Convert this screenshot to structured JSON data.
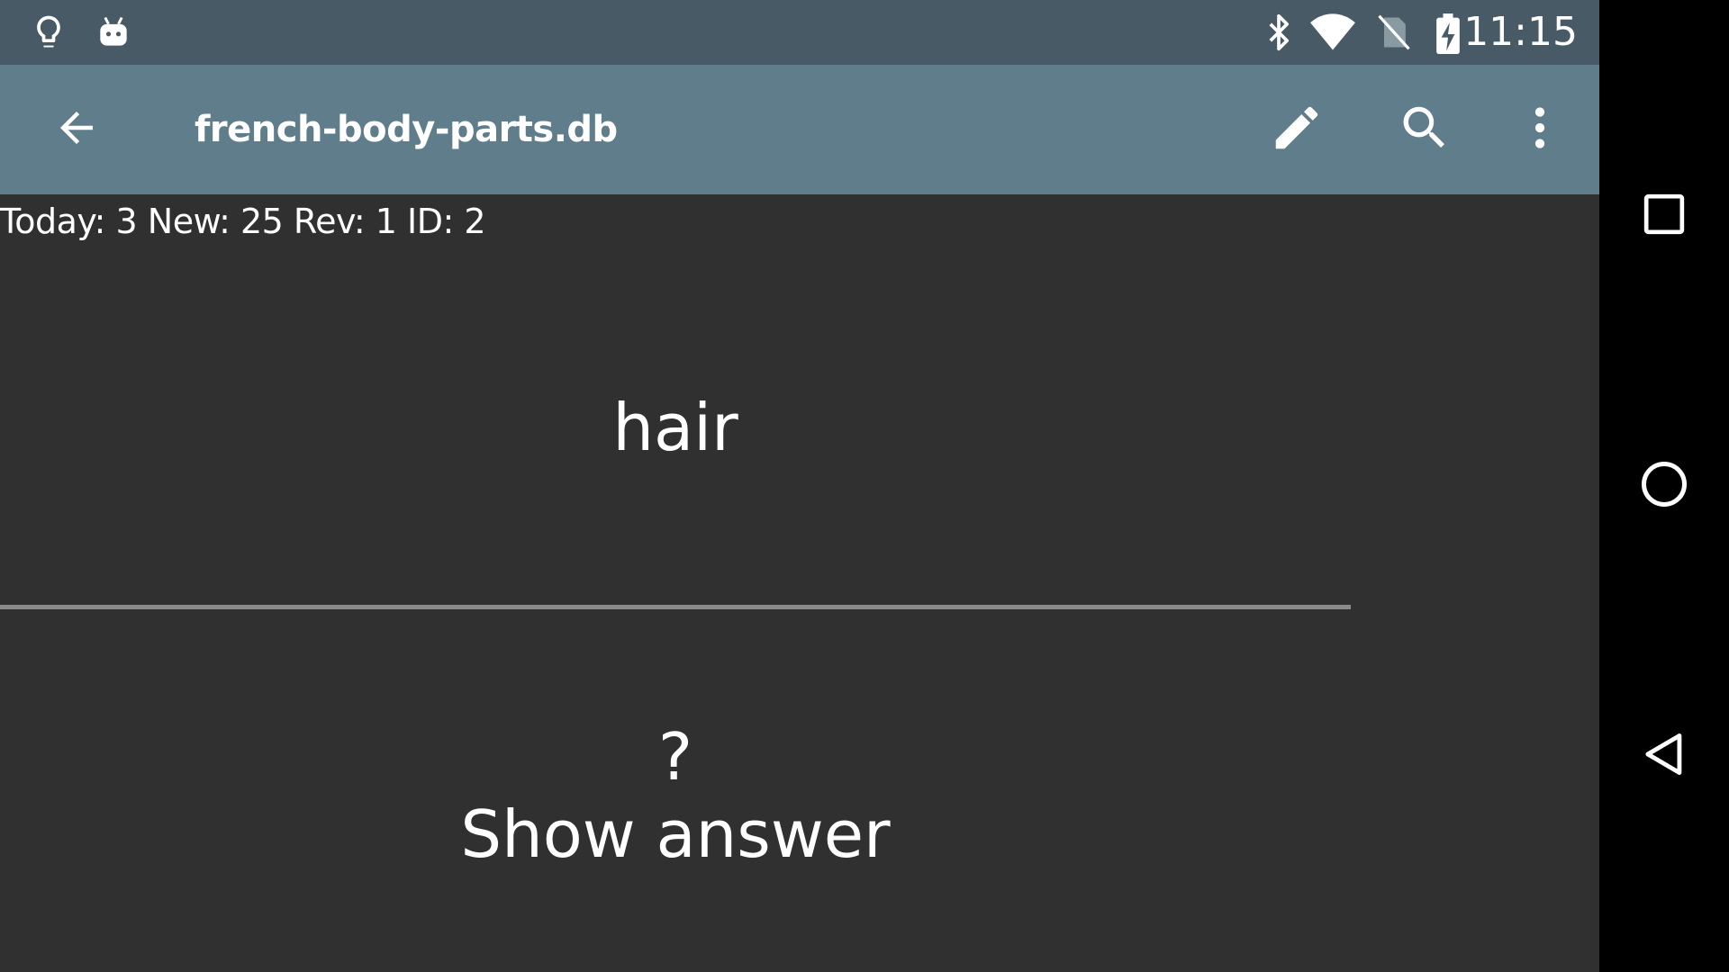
{
  "status_bar": {
    "time": "11:15",
    "left_icons": [
      "lightbulb-icon",
      "android-robot-icon"
    ],
    "right_icons": [
      "bluetooth-icon",
      "wifi-icon",
      "no-sim-icon",
      "battery-charging-icon"
    ],
    "background": "#475a66"
  },
  "app_bar": {
    "title": "french-body-parts.db",
    "background": "#607d8b",
    "actions": [
      "edit-icon",
      "search-icon",
      "more-vert-icon"
    ]
  },
  "stats": {
    "text": "Today: 3 New: 25 Rev: 1 ID: 2"
  },
  "card": {
    "question": "hair",
    "answer_placeholder": "?",
    "show_answer_label": "Show answer"
  },
  "nav_bar": {
    "buttons": [
      "recents-icon",
      "home-icon",
      "back-nav-icon"
    ]
  },
  "colors": {
    "background": "#303030",
    "divider": "#8a8a8a",
    "text": "#ffffff"
  }
}
